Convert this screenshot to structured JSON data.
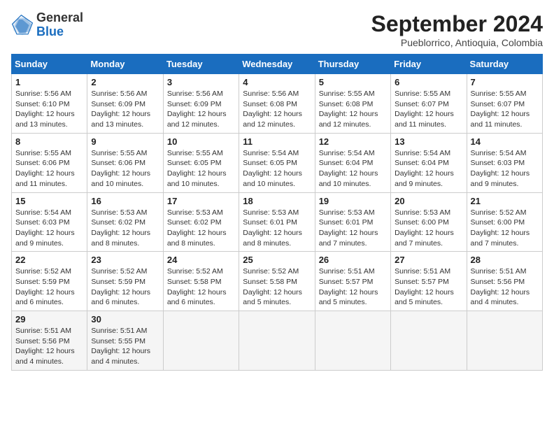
{
  "header": {
    "logo_general": "General",
    "logo_blue": "Blue",
    "month": "September 2024",
    "location": "Pueblorrico, Antioquia, Colombia"
  },
  "weekdays": [
    "Sunday",
    "Monday",
    "Tuesday",
    "Wednesday",
    "Thursday",
    "Friday",
    "Saturday"
  ],
  "days": [
    {
      "num": "",
      "detail": ""
    },
    {
      "num": "",
      "detail": ""
    },
    {
      "num": "",
      "detail": ""
    },
    {
      "num": "",
      "detail": ""
    },
    {
      "num": "",
      "detail": ""
    },
    {
      "num": "",
      "detail": ""
    },
    {
      "num": "7",
      "sr": "Sunrise: 5:55 AM",
      "ss": "Sunset: 6:07 PM",
      "dl": "Daylight: 12 hours and 11 minutes."
    },
    {
      "num": "1",
      "sr": "Sunrise: 5:56 AM",
      "ss": "Sunset: 6:10 PM",
      "dl": "Daylight: 12 hours and 13 minutes."
    },
    {
      "num": "2",
      "sr": "Sunrise: 5:56 AM",
      "ss": "Sunset: 6:09 PM",
      "dl": "Daylight: 12 hours and 13 minutes."
    },
    {
      "num": "3",
      "sr": "Sunrise: 5:56 AM",
      "ss": "Sunset: 6:09 PM",
      "dl": "Daylight: 12 hours and 12 minutes."
    },
    {
      "num": "4",
      "sr": "Sunrise: 5:56 AM",
      "ss": "Sunset: 6:08 PM",
      "dl": "Daylight: 12 hours and 12 minutes."
    },
    {
      "num": "5",
      "sr": "Sunrise: 5:55 AM",
      "ss": "Sunset: 6:08 PM",
      "dl": "Daylight: 12 hours and 12 minutes."
    },
    {
      "num": "6",
      "sr": "Sunrise: 5:55 AM",
      "ss": "Sunset: 6:07 PM",
      "dl": "Daylight: 12 hours and 11 minutes."
    },
    {
      "num": "7",
      "sr": "Sunrise: 5:55 AM",
      "ss": "Sunset: 6:07 PM",
      "dl": "Daylight: 12 hours and 11 minutes."
    },
    {
      "num": "8",
      "sr": "Sunrise: 5:55 AM",
      "ss": "Sunset: 6:06 PM",
      "dl": "Daylight: 12 hours and 11 minutes."
    },
    {
      "num": "9",
      "sr": "Sunrise: 5:55 AM",
      "ss": "Sunset: 6:06 PM",
      "dl": "Daylight: 12 hours and 10 minutes."
    },
    {
      "num": "10",
      "sr": "Sunrise: 5:55 AM",
      "ss": "Sunset: 6:05 PM",
      "dl": "Daylight: 12 hours and 10 minutes."
    },
    {
      "num": "11",
      "sr": "Sunrise: 5:54 AM",
      "ss": "Sunset: 6:05 PM",
      "dl": "Daylight: 12 hours and 10 minutes."
    },
    {
      "num": "12",
      "sr": "Sunrise: 5:54 AM",
      "ss": "Sunset: 6:04 PM",
      "dl": "Daylight: 12 hours and 10 minutes."
    },
    {
      "num": "13",
      "sr": "Sunrise: 5:54 AM",
      "ss": "Sunset: 6:04 PM",
      "dl": "Daylight: 12 hours and 9 minutes."
    },
    {
      "num": "14",
      "sr": "Sunrise: 5:54 AM",
      "ss": "Sunset: 6:03 PM",
      "dl": "Daylight: 12 hours and 9 minutes."
    },
    {
      "num": "15",
      "sr": "Sunrise: 5:54 AM",
      "ss": "Sunset: 6:03 PM",
      "dl": "Daylight: 12 hours and 9 minutes."
    },
    {
      "num": "16",
      "sr": "Sunrise: 5:53 AM",
      "ss": "Sunset: 6:02 PM",
      "dl": "Daylight: 12 hours and 8 minutes."
    },
    {
      "num": "17",
      "sr": "Sunrise: 5:53 AM",
      "ss": "Sunset: 6:02 PM",
      "dl": "Daylight: 12 hours and 8 minutes."
    },
    {
      "num": "18",
      "sr": "Sunrise: 5:53 AM",
      "ss": "Sunset: 6:01 PM",
      "dl": "Daylight: 12 hours and 8 minutes."
    },
    {
      "num": "19",
      "sr": "Sunrise: 5:53 AM",
      "ss": "Sunset: 6:01 PM",
      "dl": "Daylight: 12 hours and 7 minutes."
    },
    {
      "num": "20",
      "sr": "Sunrise: 5:53 AM",
      "ss": "Sunset: 6:00 PM",
      "dl": "Daylight: 12 hours and 7 minutes."
    },
    {
      "num": "21",
      "sr": "Sunrise: 5:52 AM",
      "ss": "Sunset: 6:00 PM",
      "dl": "Daylight: 12 hours and 7 minutes."
    },
    {
      "num": "22",
      "sr": "Sunrise: 5:52 AM",
      "ss": "Sunset: 5:59 PM",
      "dl": "Daylight: 12 hours and 6 minutes."
    },
    {
      "num": "23",
      "sr": "Sunrise: 5:52 AM",
      "ss": "Sunset: 5:59 PM",
      "dl": "Daylight: 12 hours and 6 minutes."
    },
    {
      "num": "24",
      "sr": "Sunrise: 5:52 AM",
      "ss": "Sunset: 5:58 PM",
      "dl": "Daylight: 12 hours and 6 minutes."
    },
    {
      "num": "25",
      "sr": "Sunrise: 5:52 AM",
      "ss": "Sunset: 5:58 PM",
      "dl": "Daylight: 12 hours and 5 minutes."
    },
    {
      "num": "26",
      "sr": "Sunrise: 5:51 AM",
      "ss": "Sunset: 5:57 PM",
      "dl": "Daylight: 12 hours and 5 minutes."
    },
    {
      "num": "27",
      "sr": "Sunrise: 5:51 AM",
      "ss": "Sunset: 5:57 PM",
      "dl": "Daylight: 12 hours and 5 minutes."
    },
    {
      "num": "28",
      "sr": "Sunrise: 5:51 AM",
      "ss": "Sunset: 5:56 PM",
      "dl": "Daylight: 12 hours and 4 minutes."
    },
    {
      "num": "29",
      "sr": "Sunrise: 5:51 AM",
      "ss": "Sunset: 5:56 PM",
      "dl": "Daylight: 12 hours and 4 minutes."
    },
    {
      "num": "30",
      "sr": "Sunrise: 5:51 AM",
      "ss": "Sunset: 5:55 PM",
      "dl": "Daylight: 12 hours and 4 minutes."
    }
  ]
}
